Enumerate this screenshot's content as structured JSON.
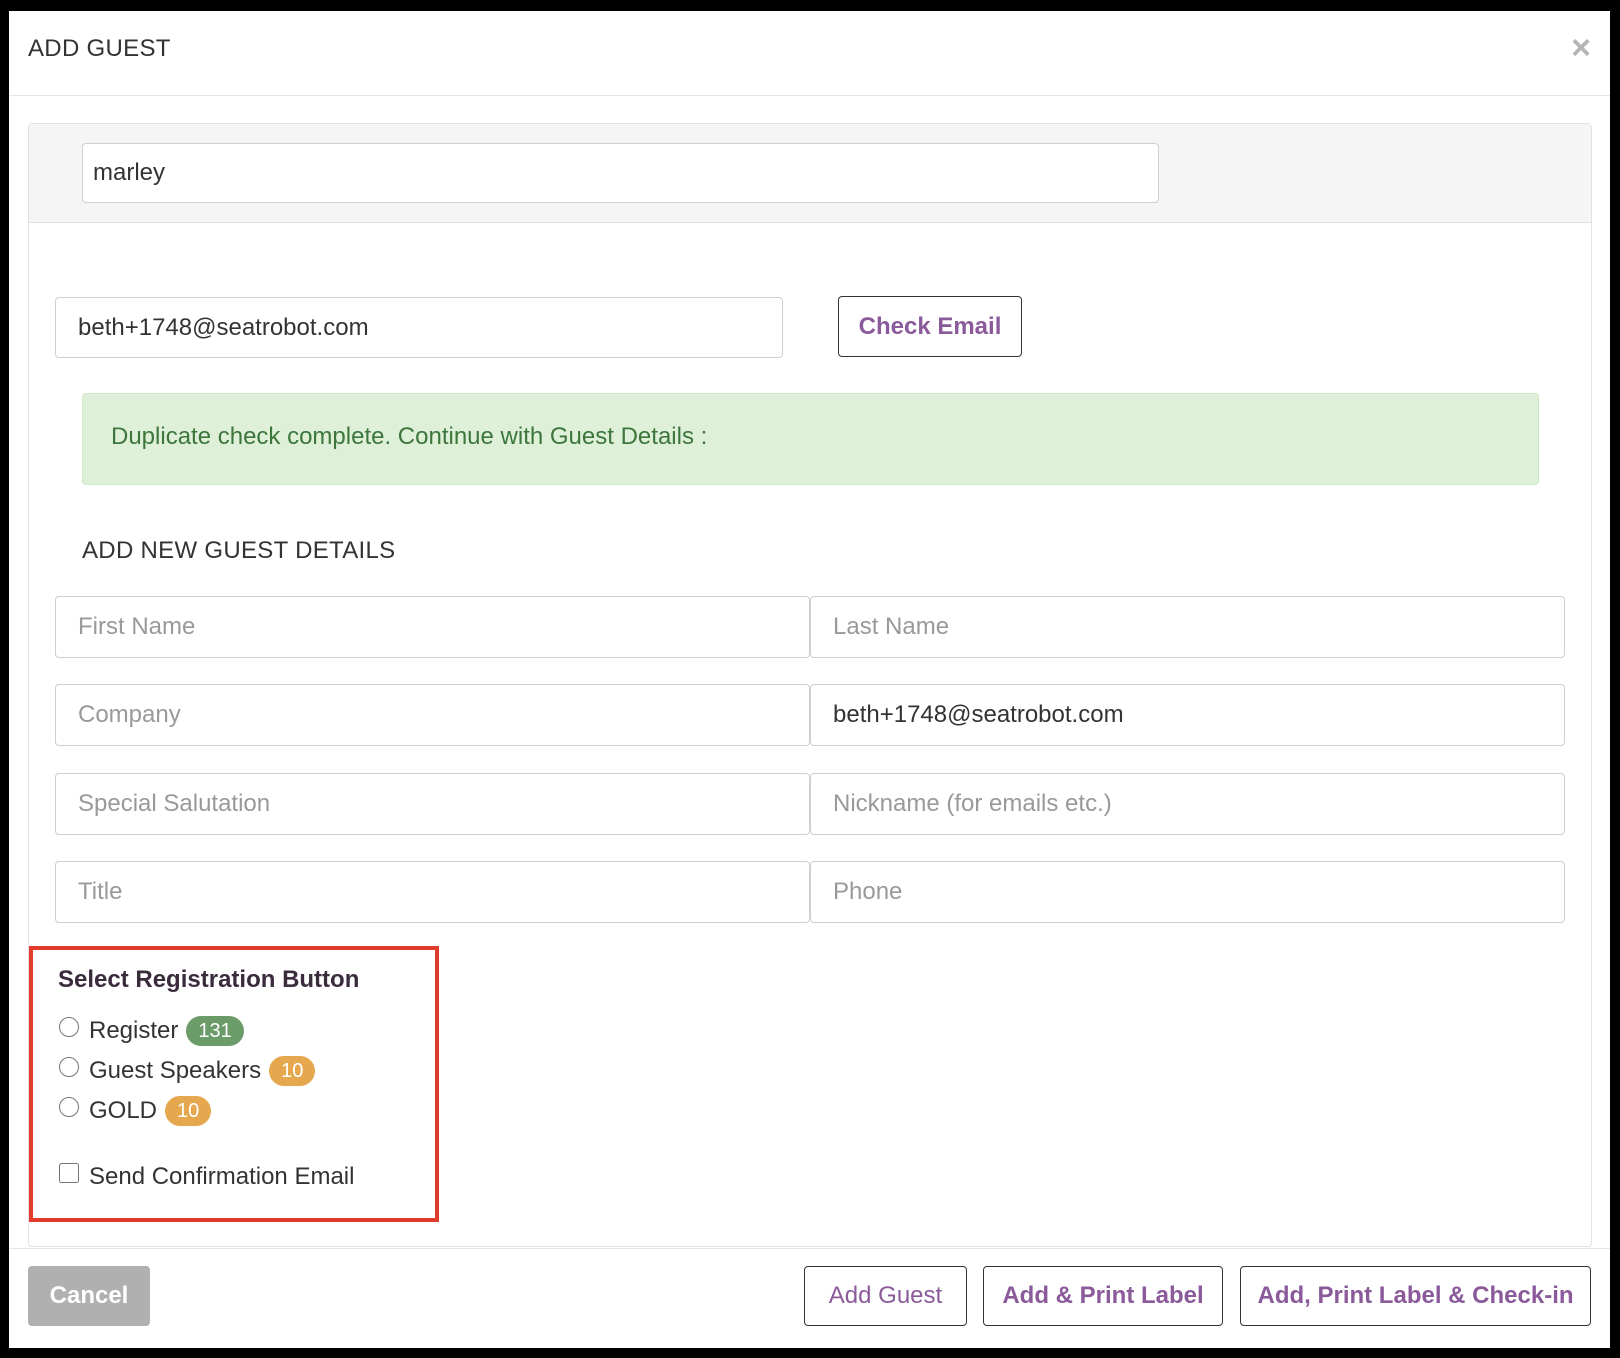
{
  "modal": {
    "title": "ADD GUEST",
    "close_label": "×"
  },
  "search": {
    "value": "marley"
  },
  "email_check": {
    "value": "beth+1748@seatrobot.com",
    "button_label": "Check Email"
  },
  "alert": {
    "message": "Duplicate check complete. Continue with Guest Details :"
  },
  "details": {
    "section_title": "ADD NEW GUEST DETAILS",
    "first_name_placeholder": "First Name",
    "last_name_placeholder": "Last Name",
    "company_placeholder": "Company",
    "email_value": "beth+1748@seatrobot.com",
    "salutation_placeholder": "Special Salutation",
    "nickname_placeholder": "Nickname (for emails etc.)",
    "title_placeholder": "Title",
    "phone_placeholder": "Phone"
  },
  "registration": {
    "title": "Select Registration Button",
    "options": [
      {
        "label": "Register",
        "count": "131",
        "badge_color": "#6c9b6a"
      },
      {
        "label": "Guest Speakers",
        "count": "10",
        "badge_color": "#e5a84f"
      },
      {
        "label": "GOLD",
        "count": "10",
        "badge_color": "#e5a84f"
      }
    ],
    "send_confirmation_label": "Send Confirmation Email"
  },
  "footer": {
    "cancel_label": "Cancel",
    "add_guest_label": "Add Guest",
    "add_print_label": "Add & Print Label",
    "add_print_checkin_label": "Add, Print Label & Check-in"
  },
  "colors": {
    "accent": "#8a5a9a",
    "success_bg": "#dff0d8",
    "success_text": "#3c763d",
    "highlight_border": "#e03b2b"
  }
}
